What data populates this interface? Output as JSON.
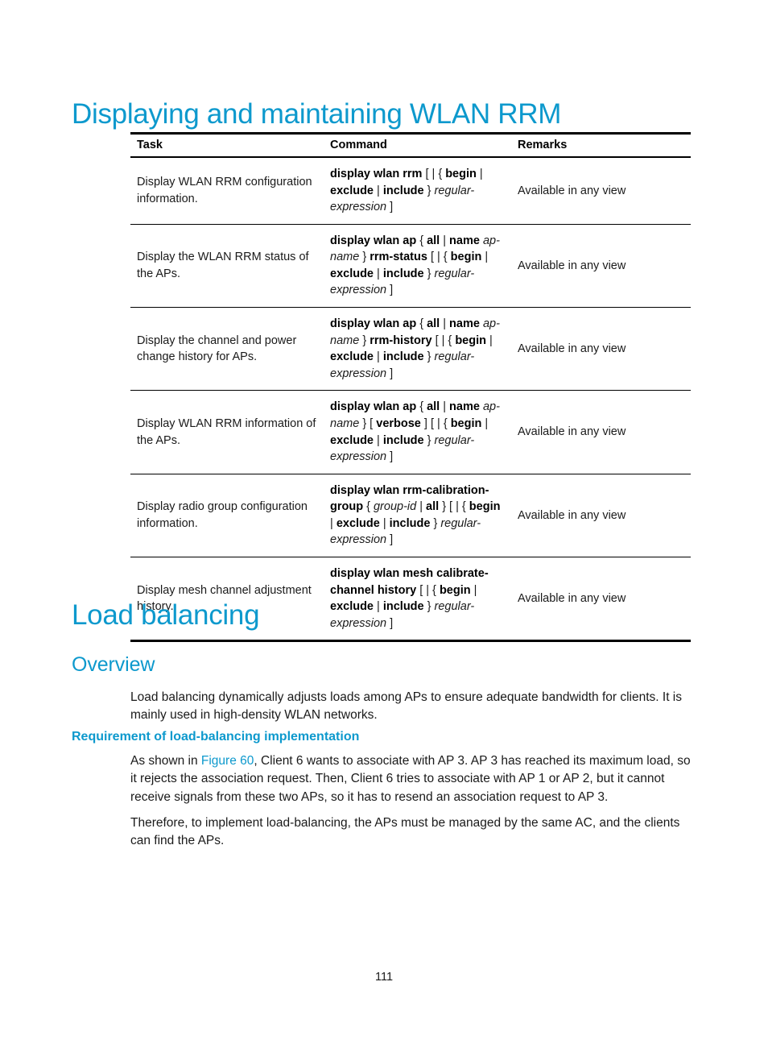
{
  "document": {
    "page_number": "111",
    "accent_color": "#0d99cd",
    "text_color": "#1a1a1a"
  },
  "headings": {
    "section_title": "Displaying and maintaining WLAN RRM",
    "chapter_title": "Load balancing",
    "subsection_title": "Overview",
    "subsubsection_title": "Requirement of load-balancing implementation"
  },
  "table": {
    "columns": [
      "Task",
      "Command",
      "Remarks"
    ],
    "rows": [
      {
        "task": "Display WLAN RRM configuration information.",
        "command_tokens": [
          {
            "t": "display wlan rrm",
            "s": "kw"
          },
          {
            "t": "[ | {",
            "s": "pn"
          },
          {
            "t": "begin",
            "s": "kw"
          },
          {
            "t": "|",
            "s": "pn"
          },
          {
            "t": "exclude",
            "s": "kw"
          },
          {
            "t": "|",
            "s": "pn"
          },
          {
            "t": "include",
            "s": "kw"
          },
          {
            "t": "}",
            "s": "pn"
          },
          {
            "t": "regular-expression",
            "s": "prm"
          },
          {
            "t": "]",
            "s": "pn"
          }
        ],
        "command_text": "display wlan rrm [ | { begin | exclude | include } regular-expression ]",
        "remarks": "Available in any view"
      },
      {
        "task": "Display the WLAN RRM status of the APs.",
        "command_tokens": [
          {
            "t": "display wlan ap",
            "s": "kw"
          },
          {
            "t": "{",
            "s": "pn"
          },
          {
            "t": "all",
            "s": "kw"
          },
          {
            "t": "|",
            "s": "pn"
          },
          {
            "t": "name",
            "s": "kw"
          },
          {
            "t": "ap-name",
            "s": "prm"
          },
          {
            "t": "}",
            "s": "pn"
          },
          {
            "t": "rrm-status",
            "s": "kw"
          },
          {
            "t": "[ | {",
            "s": "pn"
          },
          {
            "t": "begin",
            "s": "kw"
          },
          {
            "t": "|",
            "s": "pn"
          },
          {
            "t": "exclude",
            "s": "kw"
          },
          {
            "t": "|",
            "s": "pn"
          },
          {
            "t": "include",
            "s": "kw"
          },
          {
            "t": "}",
            "s": "pn"
          },
          {
            "t": "regular-expression",
            "s": "prm"
          },
          {
            "t": "]",
            "s": "pn"
          }
        ],
        "command_text": "display wlan ap { all | name ap-name } rrm-status [ | { begin | exclude | include } regular-expression ]",
        "remarks": "Available in any view"
      },
      {
        "task": "Display the channel and power change history for APs.",
        "command_tokens": [
          {
            "t": "display wlan ap",
            "s": "kw"
          },
          {
            "t": "{",
            "s": "pn"
          },
          {
            "t": "all",
            "s": "kw"
          },
          {
            "t": "|",
            "s": "pn"
          },
          {
            "t": "name",
            "s": "kw"
          },
          {
            "t": "ap-name",
            "s": "prm"
          },
          {
            "t": "}",
            "s": "pn"
          },
          {
            "t": "rrm-history",
            "s": "kw"
          },
          {
            "t": "[ | {",
            "s": "pn"
          },
          {
            "t": "begin",
            "s": "kw"
          },
          {
            "t": "|",
            "s": "pn"
          },
          {
            "t": "exclude",
            "s": "kw"
          },
          {
            "t": "|",
            "s": "pn"
          },
          {
            "t": "include",
            "s": "kw"
          },
          {
            "t": "}",
            "s": "pn"
          },
          {
            "t": "regular-expression",
            "s": "prm"
          },
          {
            "t": "]",
            "s": "pn"
          }
        ],
        "command_text": "display wlan ap { all | name ap-name } rrm-history [ | { begin | exclude | include } regular-expression ]",
        "remarks": "Available in any view"
      },
      {
        "task": "Display WLAN RRM information of the APs.",
        "command_tokens": [
          {
            "t": "display wlan ap",
            "s": "kw"
          },
          {
            "t": "{",
            "s": "pn"
          },
          {
            "t": "all",
            "s": "kw"
          },
          {
            "t": "|",
            "s": "pn"
          },
          {
            "t": "name",
            "s": "kw"
          },
          {
            "t": "ap-name",
            "s": "prm"
          },
          {
            "t": "} [",
            "s": "pn"
          },
          {
            "t": "verbose",
            "s": "kw"
          },
          {
            "t": "] [ | {",
            "s": "pn"
          },
          {
            "t": "begin",
            "s": "kw"
          },
          {
            "t": "|",
            "s": "pn"
          },
          {
            "t": "exclude",
            "s": "kw"
          },
          {
            "t": "|",
            "s": "pn"
          },
          {
            "t": "include",
            "s": "kw"
          },
          {
            "t": "}",
            "s": "pn"
          },
          {
            "t": "regular-expression",
            "s": "prm"
          },
          {
            "t": "]",
            "s": "pn"
          }
        ],
        "command_text": "display wlan ap { all | name ap-name } [ verbose ] [ | { begin | exclude | include } regular-expression ]",
        "remarks": "Available in any view"
      },
      {
        "task": "Display radio group configuration information.",
        "command_tokens": [
          {
            "t": "display wlan",
            "s": "kw"
          },
          {
            "t": "rrm-calibration-group",
            "s": "kw"
          },
          {
            "t": "{",
            "s": "pn"
          },
          {
            "t": "group-id",
            "s": "prm"
          },
          {
            "t": "|",
            "s": "pn"
          },
          {
            "t": "all",
            "s": "kw"
          },
          {
            "t": "} [ | {",
            "s": "pn"
          },
          {
            "t": "begin",
            "s": "kw"
          },
          {
            "t": "|",
            "s": "pn"
          },
          {
            "t": "exclude",
            "s": "kw"
          },
          {
            "t": "|",
            "s": "pn"
          },
          {
            "t": "include",
            "s": "kw"
          },
          {
            "t": "}",
            "s": "pn"
          },
          {
            "t": "regular-expression",
            "s": "prm"
          },
          {
            "t": "]",
            "s": "pn"
          }
        ],
        "command_text": "display wlan rrm-calibration-group { group-id | all } [ | { begin | exclude | include } regular-expression ]",
        "remarks": "Available in any view"
      },
      {
        "task": "Display mesh channel adjustment history.",
        "command_tokens": [
          {
            "t": "display wlan mesh",
            "s": "kw"
          },
          {
            "t": "calibrate-channel history",
            "s": "kw"
          },
          {
            "t": "[ | {",
            "s": "pn"
          },
          {
            "t": "begin",
            "s": "kw"
          },
          {
            "t": "|",
            "s": "pn"
          },
          {
            "t": "exclude",
            "s": "kw"
          },
          {
            "t": "|",
            "s": "pn"
          },
          {
            "t": "include",
            "s": "kw"
          },
          {
            "t": "}",
            "s": "pn"
          },
          {
            "t": "regular-expression",
            "s": "prm"
          },
          {
            "t": "]",
            "s": "pn"
          }
        ],
        "command_text": "display wlan mesh calibrate-channel history [ | { begin | exclude | include } regular-expression ]",
        "remarks": "Available in any view"
      }
    ]
  },
  "paragraphs": {
    "overview": "Load balancing dynamically adjusts loads among APs to ensure adequate bandwidth for clients. It is mainly used in high-density WLAN networks.",
    "figure_intro": "As shown in ",
    "figure_link": "Figure 60",
    "figure_rest": ", Client 6 wants to associate with AP 3. AP 3 has reached its maximum load, so it rejects the association request. Then, Client 6 tries to associate with AP 1 or AP 2, but it cannot receive signals from these two APs, so it has to resend an association request to AP 3.",
    "therefore": "Therefore, to implement load-balancing, the APs must be managed by the same AC, and the clients can find the APs."
  }
}
